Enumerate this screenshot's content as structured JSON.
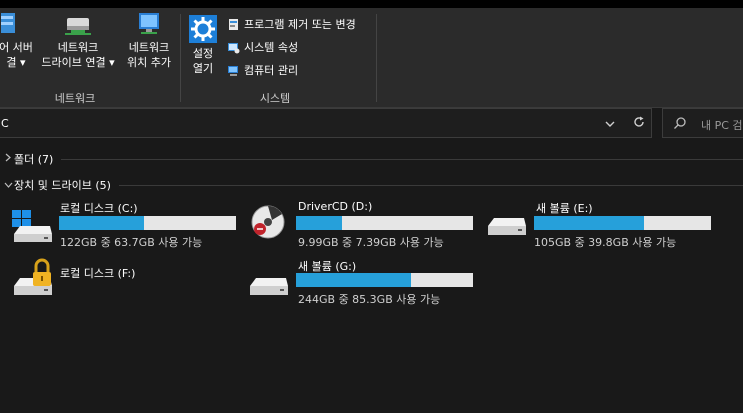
{
  "ribbon": {
    "network_group": {
      "label": "네트워크",
      "buttons": [
        {
          "line1": "어 서버",
          "line2": "결 ▾"
        },
        {
          "line1": "네트워크",
          "line2": "드라이브 연결 ▾"
        },
        {
          "line1": "네트워크",
          "line2": "위치 추가"
        }
      ]
    },
    "system_group": {
      "label": "시스템",
      "settings": {
        "line1": "설정",
        "line2": "열기"
      },
      "items": [
        {
          "label": "프로그램 제거 또는 변경",
          "icon": "uninstall-icon"
        },
        {
          "label": "시스템 속성",
          "icon": "system-properties-icon"
        },
        {
          "label": "컴퓨터 관리",
          "icon": "computer-management-icon"
        }
      ]
    }
  },
  "address": {
    "path": "C",
    "search_placeholder": "내 PC 검"
  },
  "sections": {
    "folders": "폴더 (7)",
    "devices": "장치 및 드라이브 (5)"
  },
  "drives": [
    {
      "name": "로컬 디스크 (C:)",
      "free": "122GB 중 63.7GB 사용 가능",
      "used_fraction": 0.48,
      "icon": "windows-drive-icon"
    },
    {
      "name": "DriverCD (D:)",
      "free": "9.99GB 중 7.39GB 사용 가능",
      "used_fraction": 0.26,
      "icon": "cd-drive-icon"
    },
    {
      "name": "새 볼륨 (E:)",
      "free": "105GB 중 39.8GB 사용 가능",
      "used_fraction": 0.62,
      "icon": "hard-drive-icon"
    },
    {
      "name": "로컬 디스크 (F:)",
      "free": "",
      "used_fraction": null,
      "icon": "locked-drive-icon"
    },
    {
      "name": "새 볼륨 (G:)",
      "free": "244GB 중 85.3GB 사용 가능",
      "used_fraction": 0.65,
      "icon": "hard-drive-icon"
    }
  ],
  "colors": {
    "bar_fill": "#26a0da",
    "bar_track": "#e6e6e6",
    "background": "#191919"
  }
}
